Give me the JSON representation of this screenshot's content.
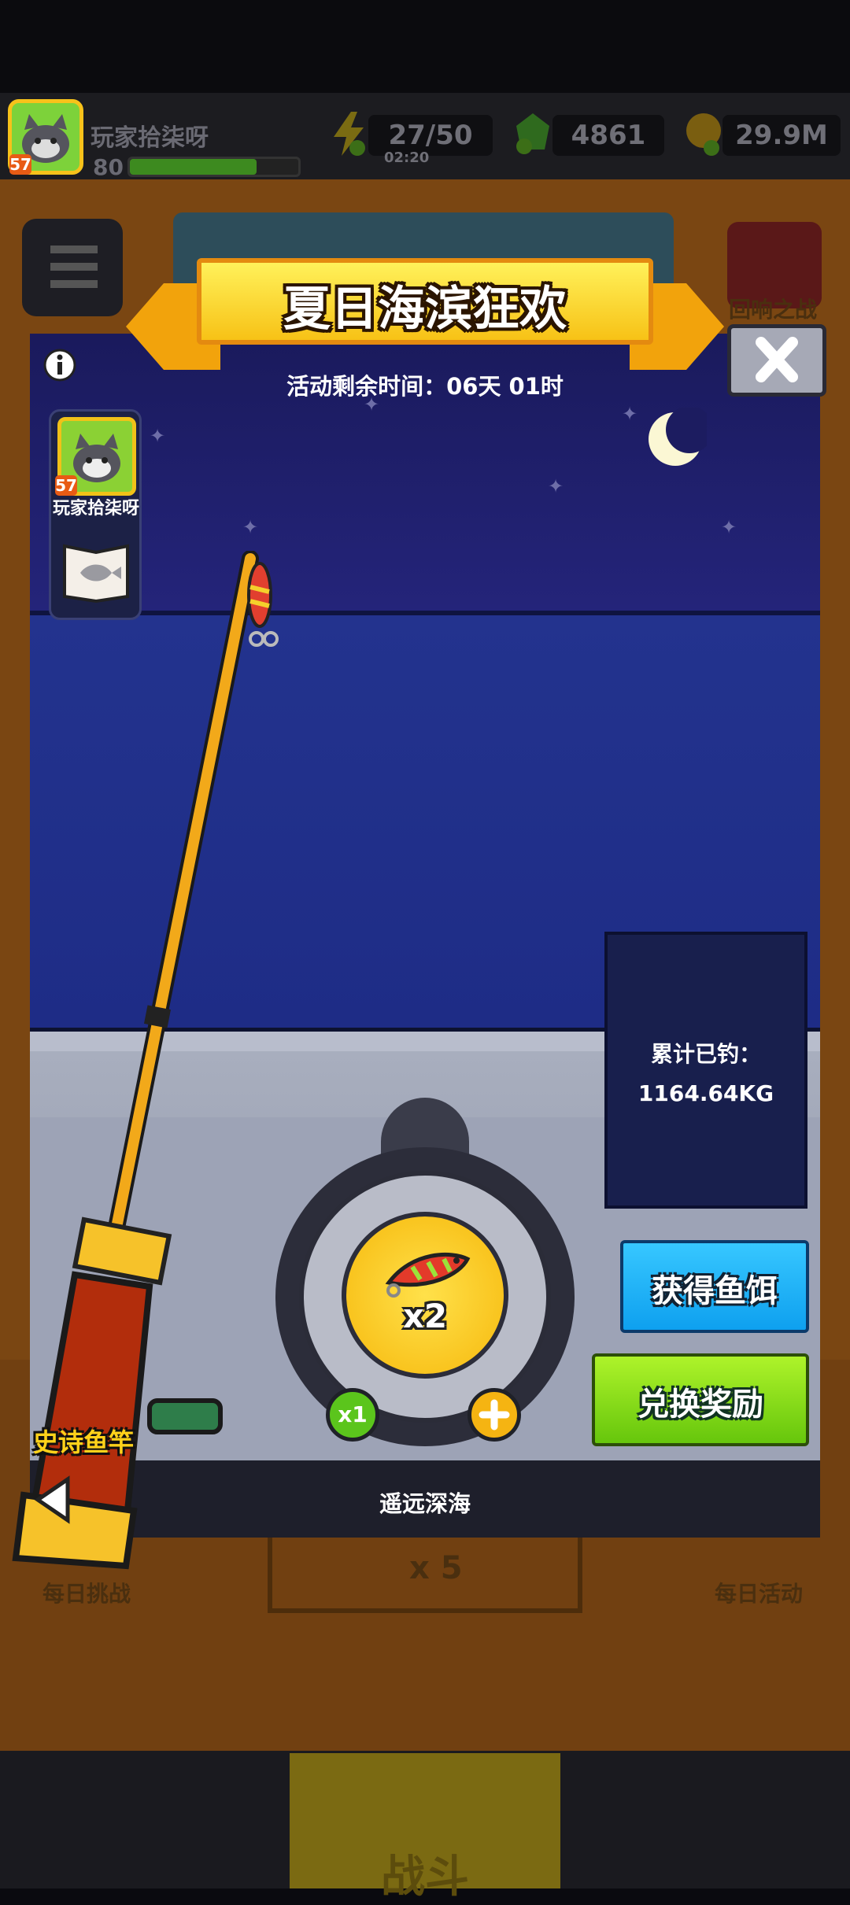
{
  "hud": {
    "player_name": "玩家拾柒呀",
    "player_level": "80",
    "avatar_badge": "57",
    "energy": "27/50",
    "energy_timer": "02:20",
    "gems": "4861",
    "coins": "29.9M",
    "xp_fraction": 0.75
  },
  "background": {
    "right_event_label": "回响之战",
    "daily_challenge": "每日挑战",
    "daily_event": "每日活动",
    "center_cost": "x 5",
    "nav_battle": "战斗"
  },
  "event": {
    "title": "夏日海滨狂欢",
    "remaining_time": "活动剩余时间：06天 01时",
    "side_player_name": "玩家拾柒呀",
    "side_avatar_badge": "57",
    "caught_label": "累计已钓：",
    "caught_value": "1164.64KG",
    "bait_multiplier": "x2",
    "x1_label": "x1",
    "get_bait_button": "获得鱼饵",
    "redeem_button": "兑换奖励",
    "rod_name": "史诗鱼竿",
    "location": "遥远深海"
  },
  "colors": {
    "banner": "#f7c216",
    "get_bait": "#1aaef5",
    "redeem": "#7fd815",
    "rod_label": "#ffd21a"
  },
  "icons": [
    "menu-icon",
    "info-icon",
    "close-icon",
    "fish-book-icon",
    "lure-icon",
    "plus-icon",
    "prev-arrow-icon",
    "energy-icon",
    "gem-icon",
    "coin-icon"
  ]
}
